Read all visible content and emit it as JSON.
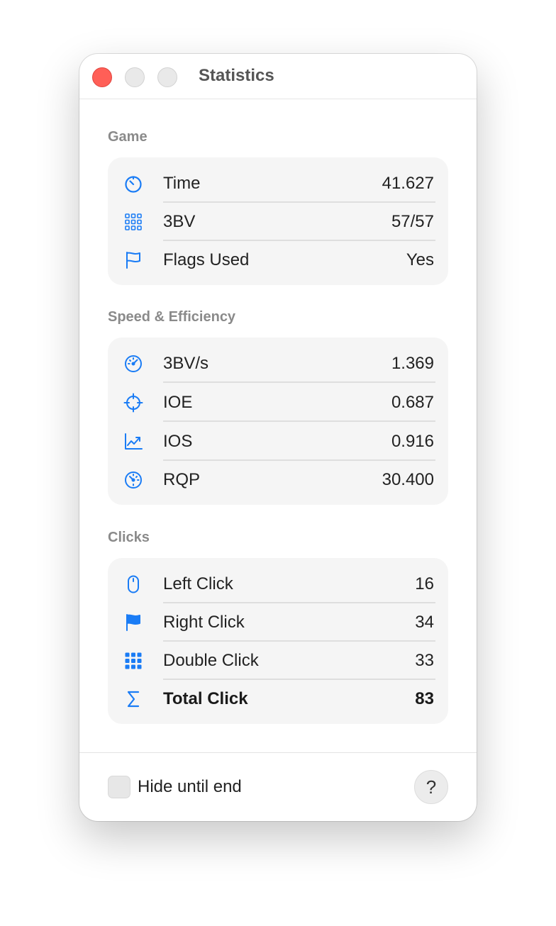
{
  "window": {
    "title": "Statistics"
  },
  "sections": {
    "game": {
      "label": "Game",
      "rows": [
        {
          "icon": "timer-icon",
          "label": "Time",
          "value": "41.627"
        },
        {
          "icon": "grid-outline-icon",
          "label": "3BV",
          "value": "57/57"
        },
        {
          "icon": "flag-outline-icon",
          "label": "Flags Used",
          "value": "Yes"
        }
      ]
    },
    "speed": {
      "label": "Speed & Efficiency",
      "rows": [
        {
          "icon": "speedometer-icon",
          "label": "3BV/s",
          "value": "1.369"
        },
        {
          "icon": "crosshair-icon",
          "label": "IOE",
          "value": "0.687"
        },
        {
          "icon": "trend-up-chart-icon",
          "label": "IOS",
          "value": "0.916"
        },
        {
          "icon": "gauge-icon",
          "label": "RQP",
          "value": "30.400"
        }
      ]
    },
    "clicks": {
      "label": "Clicks",
      "rows": [
        {
          "icon": "mouse-icon",
          "label": "Left Click",
          "value": "16"
        },
        {
          "icon": "flag-filled-icon",
          "label": "Right Click",
          "value": "34"
        },
        {
          "icon": "grid-filled-icon",
          "label": "Double Click",
          "value": "33"
        },
        {
          "icon": "sigma-icon",
          "label": "Total Click",
          "value": "83"
        }
      ]
    }
  },
  "footer": {
    "checkbox_label": "Hide until end",
    "checkbox_checked": false,
    "help_label": "?"
  },
  "colors": {
    "accent": "#1a7cf5",
    "close_button": "#ff5f57",
    "card_background": "#f5f5f5"
  }
}
